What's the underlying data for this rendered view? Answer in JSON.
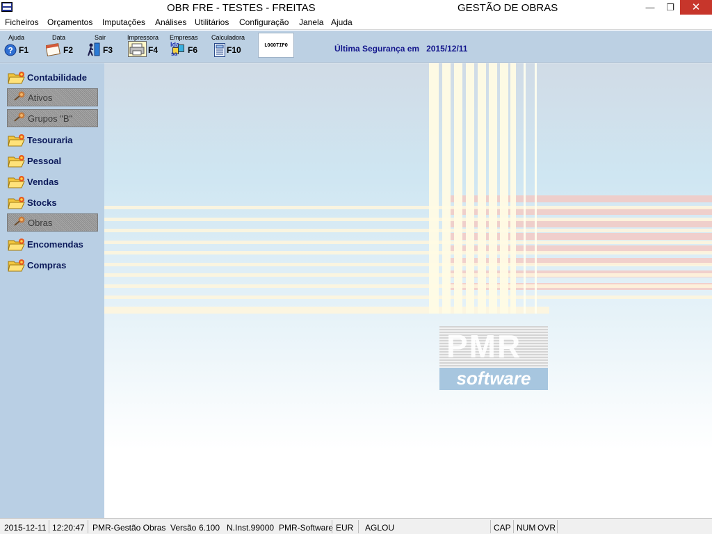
{
  "window": {
    "app_name": "OBR FRE - TESTES - FREITAS",
    "module_title": "GESTÃO DE OBRAS",
    "min_glyph": "—",
    "max_glyph": "❐",
    "close_glyph": "✕"
  },
  "menu": [
    "Ficheiros",
    "Orçamentos",
    "Imputações",
    "Análises",
    "Utilitários",
    "Configuração",
    "Janela",
    "Ajuda"
  ],
  "toolbar": {
    "tools": [
      {
        "caption": "Ajuda",
        "key": "F1",
        "icon": "help-icon"
      },
      {
        "caption": "Data",
        "key": "F2",
        "icon": "calendar-icon"
      },
      {
        "caption": "Sair",
        "key": "F3",
        "icon": "exit-icon"
      },
      {
        "caption": "Impressora",
        "key": "F4",
        "icon": "printer-icon"
      },
      {
        "caption": "Empresas",
        "key": "F6",
        "icon": "companies-icon"
      },
      {
        "caption": "Calculadora",
        "key": "F10",
        "icon": "calculator-icon"
      }
    ],
    "companies_icon_text": "lda",
    "companies_icon_sub": "sa",
    "logo_label": "LOGOTIPO",
    "security_label": "Última Segurança em",
    "security_date": "2015/12/11"
  },
  "sidebar": {
    "items": [
      {
        "label": "Contabilidade",
        "enabled": true
      },
      {
        "label": "Ativos",
        "enabled": false
      },
      {
        "label": "Grupos \"B\"",
        "enabled": false
      },
      {
        "label": "Tesouraria",
        "enabled": true
      },
      {
        "label": "Pessoal",
        "enabled": true
      },
      {
        "label": "Vendas",
        "enabled": true
      },
      {
        "label": "Stocks",
        "enabled": true
      },
      {
        "label": "Obras",
        "enabled": false
      },
      {
        "label": "Encomendas",
        "enabled": true
      },
      {
        "label": "Compras",
        "enabled": true
      }
    ]
  },
  "branding": {
    "pmr": "PMR",
    "software": "software"
  },
  "statusbar": {
    "date": "2015-12-11",
    "time": "12:20:47",
    "product": "PMR-Gestão Obras",
    "version_label": "Versão",
    "version": "6.100",
    "install": "N.Inst.99000",
    "vendor": "PMR-Software",
    "currency": "EUR",
    "user": "AGLOU",
    "cap": "CAP",
    "num": "NUM",
    "ovr": "OVR"
  },
  "colors": {
    "accent": "#13168c",
    "sidebar_bg": "#b9cfe4",
    "toolbar_bg": "#bcd0e3",
    "close_button": "#c7362b"
  }
}
